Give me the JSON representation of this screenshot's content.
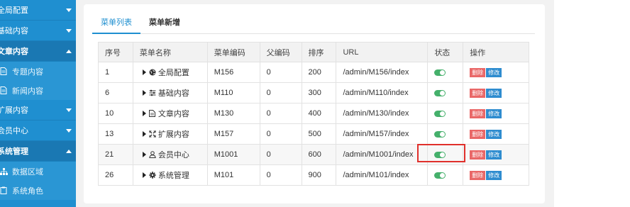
{
  "sidebar": {
    "groups": [
      {
        "label": "全局配置"
      },
      {
        "label": "基础内容"
      },
      {
        "label": "文章内容",
        "subs": [
          {
            "label": "专题内容"
          },
          {
            "label": "新闻内容"
          }
        ]
      },
      {
        "label": "扩展内容"
      },
      {
        "label": "会员中心"
      },
      {
        "label": "系统管理",
        "subs": [
          {
            "label": "数据区域"
          },
          {
            "label": "系统角色"
          }
        ]
      }
    ]
  },
  "tabs": [
    {
      "label": "菜单列表"
    },
    {
      "label": "菜单新增"
    }
  ],
  "table": {
    "headers": [
      "序号",
      "菜单名称",
      "菜单编码",
      "父编码",
      "排序",
      "URL",
      "状态",
      "操作"
    ],
    "rows": [
      {
        "seq": "1",
        "name": "全局配置",
        "icon": "globe-icon",
        "code": "M156",
        "parent": "0",
        "order": "200",
        "url": "/admin/M156/index"
      },
      {
        "seq": "6",
        "name": "基础内容",
        "icon": "sliders-icon",
        "code": "M110",
        "parent": "0",
        "order": "300",
        "url": "/admin/M110/index"
      },
      {
        "seq": "10",
        "name": "文章内容",
        "icon": "document-icon",
        "code": "M130",
        "parent": "0",
        "order": "400",
        "url": "/admin/M130/index"
      },
      {
        "seq": "13",
        "name": "扩展内容",
        "icon": "expand-icon",
        "code": "M157",
        "parent": "0",
        "order": "500",
        "url": "/admin/M157/index"
      },
      {
        "seq": "21",
        "name": "会员中心",
        "icon": "user-icon",
        "code": "M1001",
        "parent": "0",
        "order": "600",
        "url": "/admin/M1001/index"
      },
      {
        "seq": "26",
        "name": "系统管理",
        "icon": "gear-icon",
        "code": "M101",
        "parent": "0",
        "order": "900",
        "url": "/admin/M101/index"
      }
    ],
    "delete_label": "删除",
    "edit_label": "修改"
  },
  "colors": {
    "sidebar": "#1f8fd0",
    "accent": "#1f8fd0",
    "toggle_on": "#45b06b",
    "delete": "#e96767",
    "edit": "#2e8ccf",
    "highlight_box": "#e0302c"
  }
}
